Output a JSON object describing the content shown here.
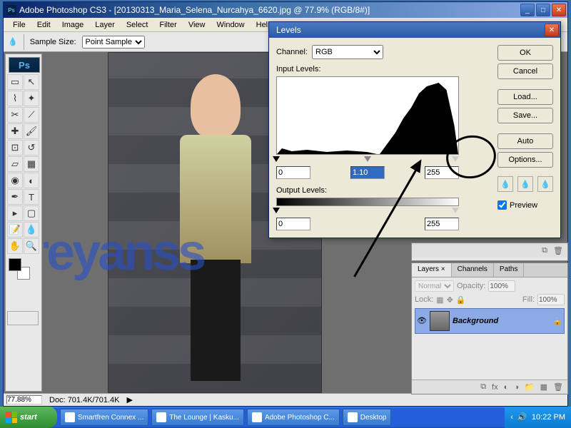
{
  "app": {
    "title": "Adobe Photoshop CS3 - [20130313_Maria_Selena_Nurcahya_6620.jpg @ 77.9% (RGB/8#)]",
    "ps_badge": "Ps"
  },
  "menu": [
    "File",
    "Edit",
    "Image",
    "Layer",
    "Select",
    "Filter",
    "View",
    "Window",
    "Help"
  ],
  "options": {
    "sample_label": "Sample Size:",
    "sample_value": "Point Sample"
  },
  "status": {
    "zoom": "77.88%",
    "doc_label": "Doc:",
    "doc_value": "701.4K/701.4K"
  },
  "watermark": "reyanss",
  "dialog": {
    "title": "Levels",
    "channel_label": "Channel:",
    "channel_value": "RGB",
    "input_label": "Input Levels:",
    "output_label": "Output Levels:",
    "in_black": "0",
    "in_gamma": "1.10",
    "in_white": "255",
    "out_black": "0",
    "out_white": "255",
    "buttons": {
      "ok": "OK",
      "cancel": "Cancel",
      "load": "Load...",
      "save": "Save...",
      "auto": "Auto",
      "options": "Options..."
    },
    "preview_label": "Preview"
  },
  "layers_panel": {
    "tabs": [
      "Layers ×",
      "Channels",
      "Paths"
    ],
    "blend": "Normal",
    "opacity_label": "Opacity:",
    "opacity": "100%",
    "lock_label": "Lock:",
    "fill_label": "Fill:",
    "fill": "100%",
    "layer_name": "Background"
  },
  "taskbar": {
    "start": "start",
    "items": [
      "Smartfren Connex ...",
      "The Lounge | Kasku...",
      "Adobe Photoshop C...",
      "Desktop"
    ],
    "time": "10:22 PM"
  }
}
